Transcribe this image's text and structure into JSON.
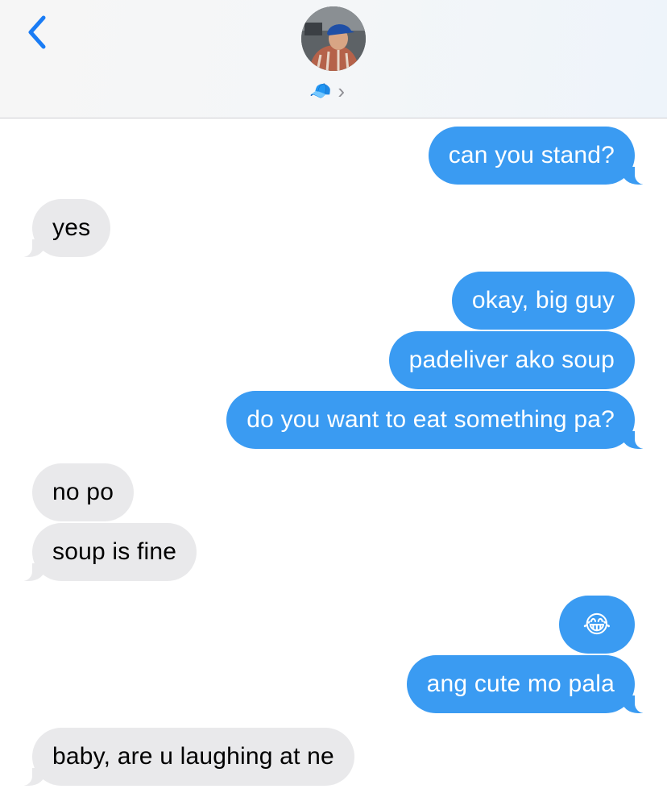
{
  "header": {
    "contact_emoji": "🧢",
    "chevron": "›"
  },
  "messages": [
    {
      "from": "me",
      "text": "can you stand?"
    },
    {
      "from": "them",
      "text": "yes"
    },
    {
      "from": "me",
      "text": "okay, big guy"
    },
    {
      "from": "me",
      "text": "padeliver ako soup"
    },
    {
      "from": "me",
      "text": "do you want to eat something pa?"
    },
    {
      "from": "them",
      "text": "no po"
    },
    {
      "from": "them",
      "text": "soup is fine"
    },
    {
      "from": "me",
      "text": "😂"
    },
    {
      "from": "me",
      "text": "ang cute mo pala"
    },
    {
      "from": "them",
      "text": "baby, are u laughing at ne"
    }
  ],
  "colors": {
    "sent_bubble": "#3a9bf2",
    "received_bubble": "#e9e9eb",
    "accent": "#1a7cf5"
  }
}
